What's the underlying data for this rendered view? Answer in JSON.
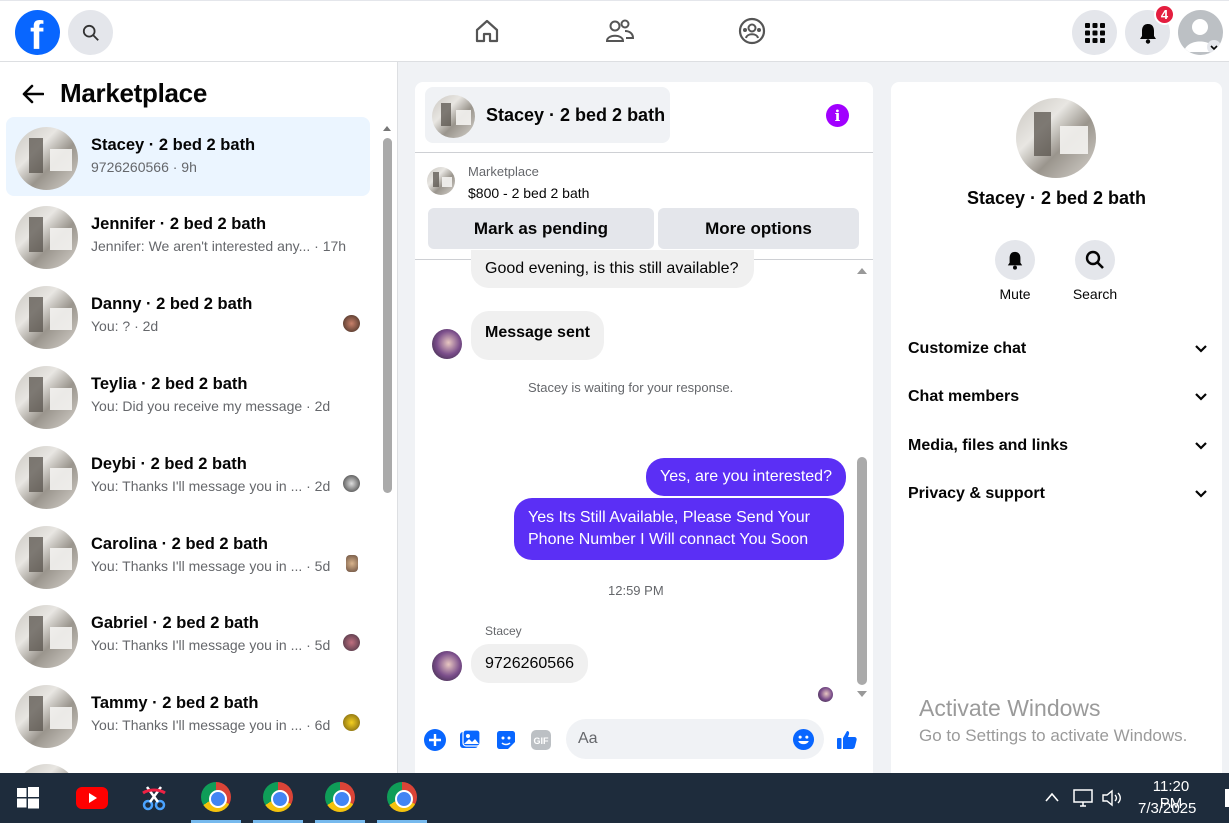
{
  "topbar": {
    "logo_letter": "f",
    "notification_count": "4"
  },
  "sidebar": {
    "title": "Marketplace",
    "conversations": [
      {
        "name": "Stacey · 2 bed 2 bath",
        "preview": "9726260566 · 9h",
        "active": true
      },
      {
        "name": "Jennifer · 2 bed 2 bath",
        "preview": "Jennifer: We aren't interested any... · 17h"
      },
      {
        "name": "Danny · 2 bed 2 bath",
        "preview": "You: ? · 2d"
      },
      {
        "name": "Teylia · 2 bed 2 bath",
        "preview": "You: Did you receive my message · 2d"
      },
      {
        "name": "Deybi · 2 bed 2 bath",
        "preview": "You: Thanks I'll message you in ... · 2d"
      },
      {
        "name": "Carolina · 2 bed 2 bath",
        "preview": "You: Thanks I'll message you in ... · 5d"
      },
      {
        "name": "Gabriel · 2 bed 2 bath",
        "preview": "You: Thanks I'll message you in ... · 5d"
      },
      {
        "name": "Tammy · 2 bed 2 bath",
        "preview": "You: Thanks I'll message you in ... · 6d"
      }
    ]
  },
  "chat": {
    "title": "Stacey · 2 bed 2 bath",
    "marketplace_label": "Marketplace",
    "listing": "$800 - 2 bed 2 bath",
    "mark_pending_label": "Mark as pending",
    "more_options_label": "More options",
    "messages": {
      "m1": "Good evening, is this still available?",
      "m2": "Message sent",
      "waiting": "Stacey is waiting for your response.",
      "m3": "Yes, are you interested?",
      "m4": "Yes Its Still Available, Please Send Your Phone Number I Will connact You Soon",
      "time": "12:59 PM",
      "sender": "Stacey",
      "m5": "9726260566"
    },
    "input_placeholder": "Aa"
  },
  "details": {
    "name": "Stacey · 2 bed 2 bath",
    "mute_label": "Mute",
    "search_label": "Search",
    "sections": [
      "Customize chat",
      "Chat members",
      "Media, files and links",
      "Privacy & support"
    ]
  },
  "watermark": {
    "line1": "Activate Windows",
    "line2": "Go to Settings to activate Windows."
  },
  "taskbar": {
    "time": "11:20 PM",
    "date": "7/3/2025"
  },
  "colors": {
    "facebook_blue": "#0866ff",
    "outgoing_bubble": "#5b2ff5",
    "notification_red": "#e41e3f",
    "info_purple": "#a100ff"
  }
}
